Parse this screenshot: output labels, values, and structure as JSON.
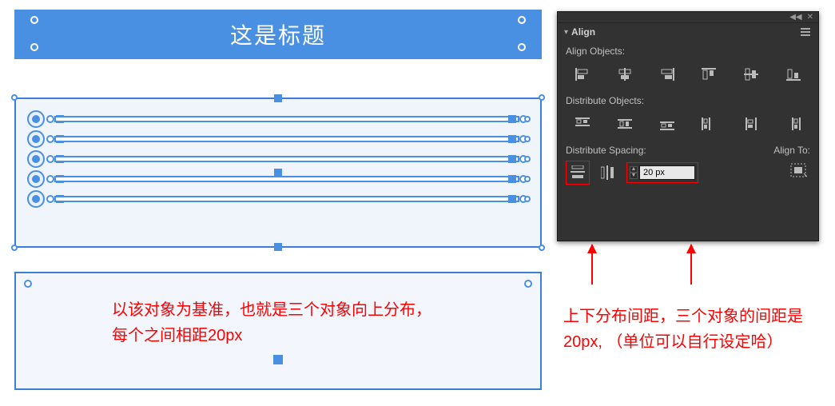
{
  "canvas": {
    "title_text": "这是标题",
    "annotation_text_line1": "以该对象为基准，也就是三个对象向上分布，",
    "annotation_text_line2": "每个之间相距20px"
  },
  "align_panel": {
    "tab_label": "Align",
    "sections": {
      "align_objects": "Align Objects:",
      "distribute_objects": "Distribute Objects:",
      "distribute_spacing": "Distribute Spacing:",
      "align_to": "Align To:"
    },
    "spacing_value": "20 px",
    "icons": {
      "align_left": "align-left-icon",
      "align_hcenter": "align-hcenter-icon",
      "align_right": "align-right-icon",
      "align_top": "align-top-icon",
      "align_vcenter": "align-vcenter-icon",
      "align_bottom": "align-bottom-icon",
      "dist_top": "distribute-top-icon",
      "dist_vcenter": "distribute-vcenter-icon",
      "dist_bottom": "distribute-bottom-icon",
      "dist_left": "distribute-left-icon",
      "dist_hcenter": "distribute-hcenter-icon",
      "dist_right": "distribute-right-icon",
      "spacing_v": "vertical-spacing-icon",
      "spacing_h": "horizontal-spacing-icon",
      "align_to_selection": "align-to-selection-icon"
    }
  },
  "right_annotation": {
    "line1": "上下分布间距，三个对象的间距是",
    "line2": "20px, （单位可以自行设定哈）"
  }
}
